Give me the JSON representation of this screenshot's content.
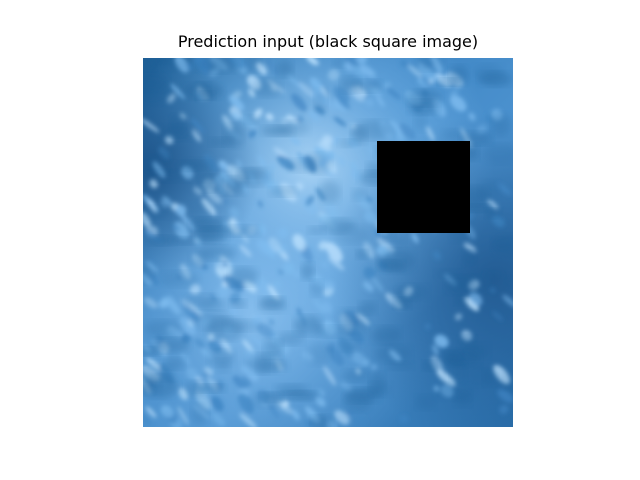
{
  "figure": {
    "title": "Prediction input (black square image)"
  },
  "image": {
    "subject": "aerial-ocean-texture",
    "palette": {
      "deep": "#1e5f96",
      "mid": "#3f86c4",
      "light": "#7fbdf0",
      "highlight": "#bfe3ff"
    },
    "mask_color": "#000000"
  }
}
